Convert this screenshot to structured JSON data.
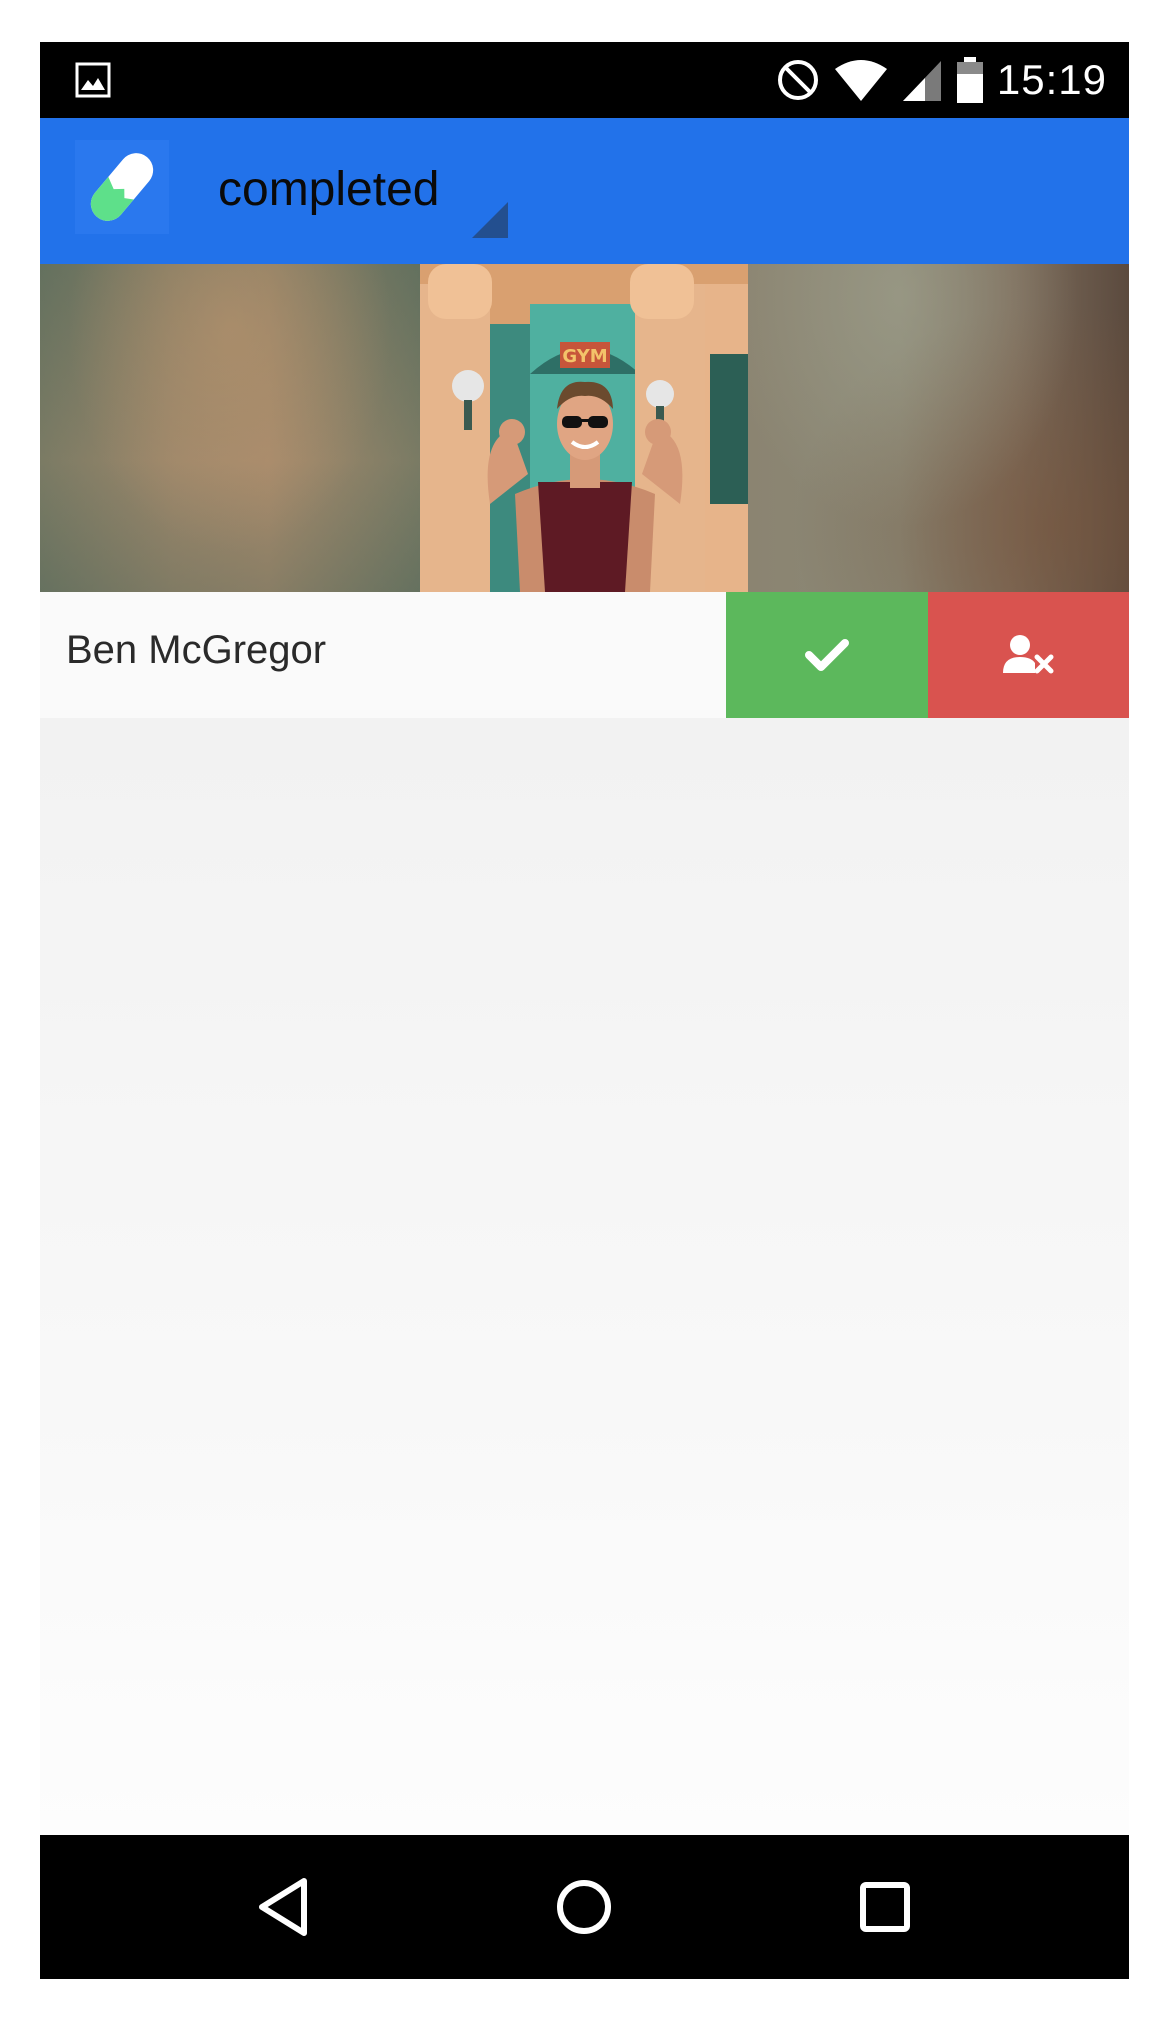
{
  "status_bar": {
    "time": "15:19",
    "icons": [
      "image-notification-icon",
      "do-not-disturb-icon",
      "wifi-icon",
      "cell-signal-icon",
      "battery-icon"
    ]
  },
  "app_bar": {
    "logo": "pill-logo-icon",
    "filter_value": "completed",
    "accent_color": "#2272ea"
  },
  "card": {
    "user_name": "Ben McGregor",
    "photo_sign_text": "GYM",
    "approve_icon": "check-icon",
    "reject_icon": "user-remove-icon",
    "approve_color": "#5cb85c",
    "reject_color": "#d9534f"
  },
  "nav_bar": {
    "buttons": [
      "back-icon",
      "home-icon",
      "recents-icon"
    ]
  }
}
